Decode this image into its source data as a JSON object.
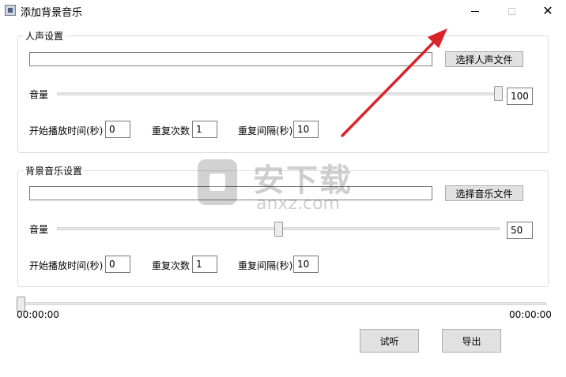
{
  "window": {
    "title": "添加背景音乐",
    "close_glyph": "✕"
  },
  "voice": {
    "legend": "人声设置",
    "file_path": "",
    "choose_button": "选择人声文件",
    "volume_label": "音量",
    "volume_value": "100",
    "volume_level": 1.0,
    "start_label": "开始播放时间(秒)",
    "start_value": "0",
    "repeat_label": "重复次数",
    "repeat_value": "1",
    "interval_label": "重复间隔(秒)",
    "interval_value": "10"
  },
  "music": {
    "legend": "背景音乐设置",
    "file_path": "",
    "choose_button": "选择音乐文件",
    "volume_label": "音量",
    "volume_value": "50",
    "volume_level": 0.5,
    "start_label": "开始播放时间(秒)",
    "start_value": "0",
    "repeat_label": "重复次数",
    "repeat_value": "1",
    "interval_label": "重复间隔(秒)",
    "interval_value": "10"
  },
  "playback": {
    "current_time": "00:00:00",
    "total_time": "00:00:00",
    "progress": 0
  },
  "actions": {
    "preview_button": "试听",
    "export_button": "导出"
  },
  "watermark": {
    "text_cn": "安下载",
    "text_en": "anxz.com"
  },
  "colors": {
    "annotation_arrow": "#d9232a"
  }
}
